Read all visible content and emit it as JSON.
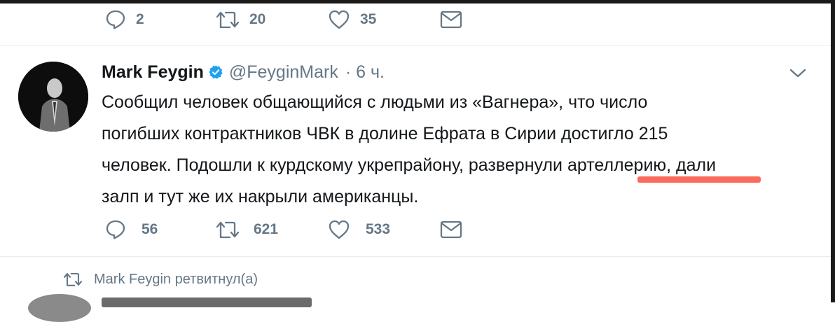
{
  "previous_tweet": {
    "actions": {
      "reply_count": "2",
      "retweet_count": "20",
      "like_count": "35"
    }
  },
  "tweet": {
    "author_name": "Mark Feygin",
    "handle": "@FeyginMark",
    "time": "· 6 ч.",
    "text_lines": [
      "Сообщил человек общающийся с людьми из «Вагнера», что число",
      "погибших контрактников ЧВК в долине Ефрата в Сирии достигло 215",
      "человек. Подошли к курдскому укрепрайону, развернули артеллерию, дали",
      "залп и тут же их накрыли американцы."
    ],
    "actions": {
      "reply_count": "56",
      "retweet_count": "621",
      "like_count": "533"
    }
  },
  "retweet_notice": {
    "text": "Mark Feygin ретвитнул(а)"
  },
  "colors": {
    "text_primary": "#14171a",
    "text_secondary": "#657786",
    "verified_blue": "#1da1f2",
    "highlight_red": "#fb6b5c",
    "divider": "#e6ecf0"
  },
  "icons": [
    "reply-icon",
    "retweet-icon",
    "like-icon",
    "message-icon",
    "verified-badge-icon",
    "chevron-down-icon",
    "avatar"
  ]
}
